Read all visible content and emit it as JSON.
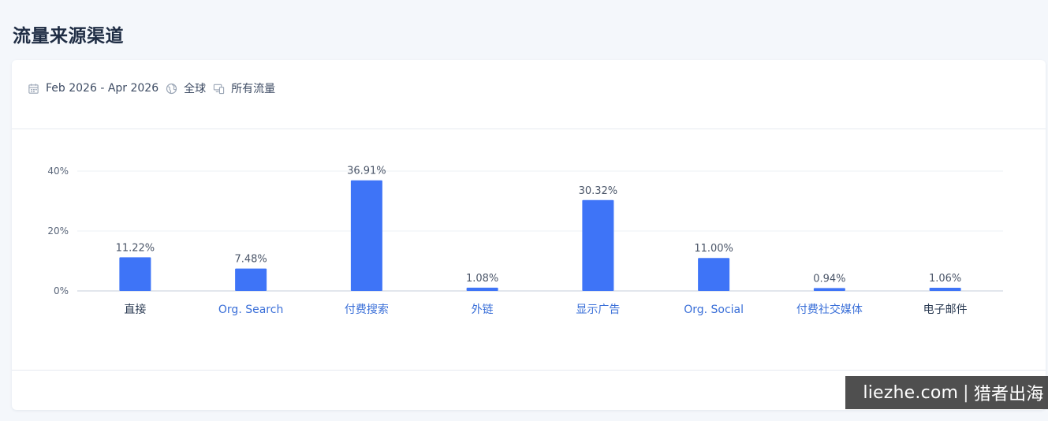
{
  "page": {
    "title": "流量来源渠道"
  },
  "filters": {
    "date_range": "Feb 2026 - Apr 2026",
    "region": "全球",
    "traffic": "所有流量"
  },
  "watermark": {
    "site": "liezhe.com",
    "separator": "|",
    "name": "猎者出海"
  },
  "colors": {
    "bar": "#3e74f7",
    "link_label": "#3a6fd8",
    "plain_label": "#2a3a52",
    "grid": "#eef1f5",
    "axis": "#c5ccd8"
  },
  "chart_data": {
    "type": "bar",
    "title": "",
    "xlabel": "",
    "ylabel": "",
    "ylim": [
      0,
      40
    ],
    "yticks": [
      0,
      20,
      40
    ],
    "ytick_labels": [
      "0%",
      "20%",
      "40%"
    ],
    "grid": true,
    "categories": [
      "直接",
      "Org. Search",
      "付费搜索",
      "外链",
      "显示广告",
      "Org. Social",
      "付费社交媒体",
      "电子邮件"
    ],
    "category_is_link": [
      false,
      true,
      true,
      true,
      true,
      true,
      true,
      false
    ],
    "values": [
      11.22,
      7.48,
      36.91,
      1.08,
      30.32,
      11.0,
      0.94,
      1.06
    ],
    "value_labels": [
      "11.22%",
      "7.48%",
      "36.91%",
      "1.08%",
      "30.32%",
      "11.00%",
      "0.94%",
      "1.06%"
    ]
  }
}
